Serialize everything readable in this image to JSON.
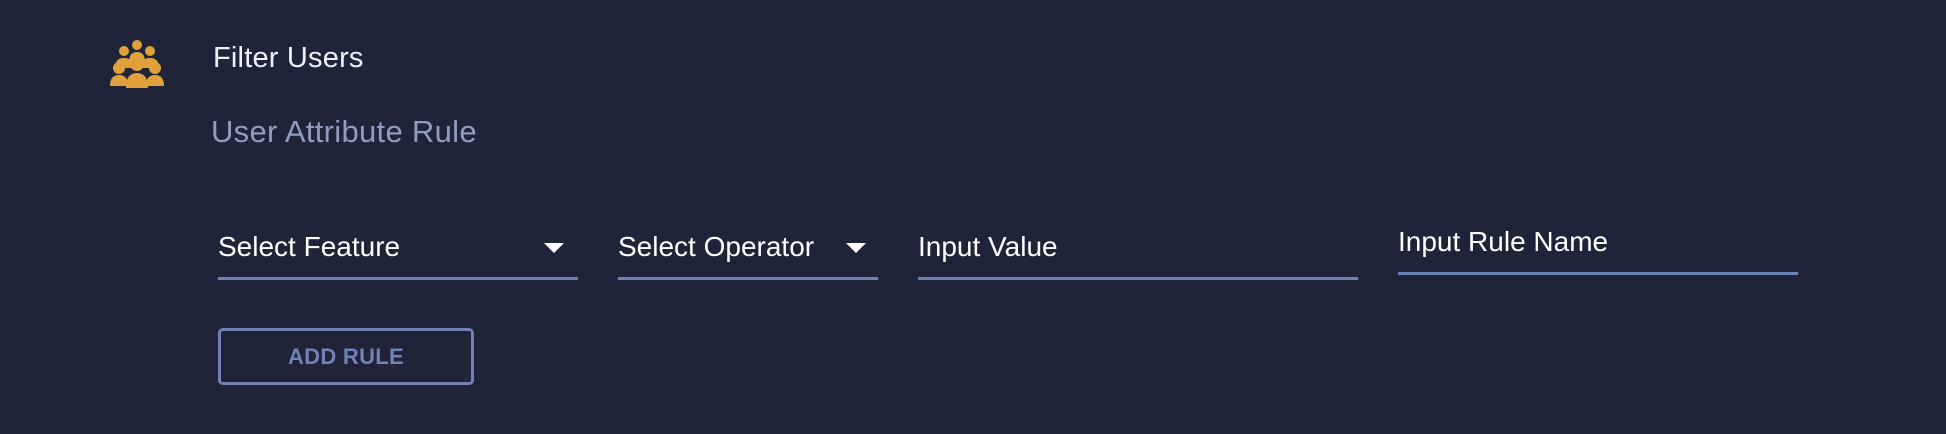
{
  "header": {
    "icon": "users-group-icon",
    "title": "Filter Users",
    "accent_color": "#e0a13a"
  },
  "rule": {
    "subtitle": "User Attribute Rule",
    "feature_select": {
      "label": "Select Feature"
    },
    "operator_select": {
      "label": "Select Operator"
    },
    "value_input": {
      "placeholder": "Input Value"
    },
    "rule_name_input": {
      "placeholder": "Input Rule Name"
    },
    "add_button_label": "ADD RULE"
  },
  "colors": {
    "background": "#1f2438",
    "underline": "#6d80b8",
    "button": "#7082b8",
    "subtitle": "#8f9dc0"
  }
}
